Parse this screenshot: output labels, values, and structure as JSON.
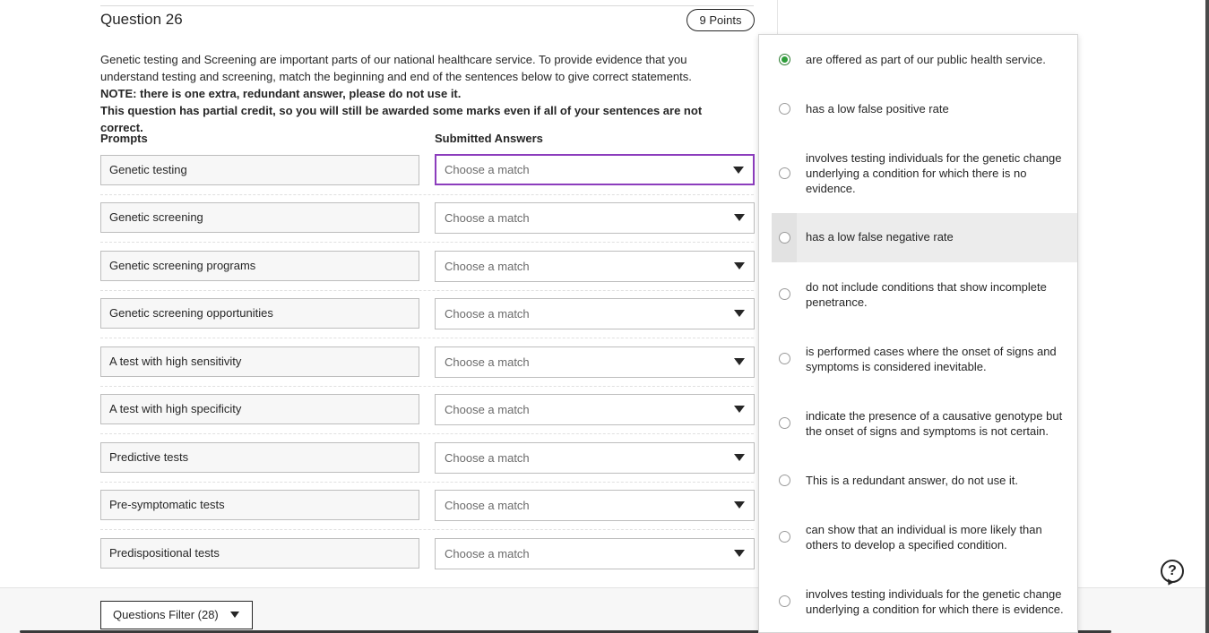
{
  "question": {
    "title": "Question 26",
    "points": "9 Points",
    "instructions": [
      "Genetic testing and Screening are important parts of our national healthcare service. To provide evidence that you understand testing and screening, match the beginning and end of the sentences below to give correct statements."
    ],
    "note": "NOTE: there is one extra, redundant answer, please do not use it.",
    "partial_credit": "This question has partial credit, so you will still be awarded some marks even if all of your sentences are not correct."
  },
  "columns": {
    "prompts": "Prompts",
    "answers": "Submitted Answers"
  },
  "rows": [
    {
      "prompt": "Genetic testing",
      "answer": "Choose a match"
    },
    {
      "prompt": "Genetic screening",
      "answer": "Choose a match"
    },
    {
      "prompt": "Genetic screening programs",
      "answer": "Choose a match"
    },
    {
      "prompt": "Genetic screening opportunities",
      "answer": "Choose a match"
    },
    {
      "prompt": "A test with high sensitivity",
      "answer": "Choose a match"
    },
    {
      "prompt": "A test with high specificity",
      "answer": "Choose a match"
    },
    {
      "prompt": "Predictive tests",
      "answer": "Choose a match"
    },
    {
      "prompt": "Pre-symptomatic tests",
      "answer": "Choose a match"
    },
    {
      "prompt": "Predispositional tests",
      "answer": "Choose a match"
    }
  ],
  "dropdown": {
    "options": [
      {
        "label": "are offered as part of our public health service.",
        "selected": true
      },
      {
        "label": "has a low false positive rate",
        "selected": false
      },
      {
        "label": "involves testing individuals for the genetic change underlying a condition for which there is no evidence.",
        "selected": false
      },
      {
        "label": "has a low false negative rate",
        "selected": false,
        "highlighted": true
      },
      {
        "label": "do not include conditions that show incomplete penetrance.",
        "selected": false
      },
      {
        "label": "is performed cases where the onset of signs and symptoms is considered inevitable.",
        "selected": false
      },
      {
        "label": "indicate the presence of a causative genotype but the onset of signs and symptoms is not certain.",
        "selected": false
      },
      {
        "label": "This is a redundant answer, do not use it.",
        "selected": false
      },
      {
        "label": "can show that an individual is more likely than others to develop a specified condition.",
        "selected": false
      },
      {
        "label": "involves testing individuals for the genetic change underlying a condition for which there is evidence.",
        "selected": false
      }
    ]
  },
  "footer": {
    "filter_label": "Questions Filter (28)"
  },
  "icons": {
    "help": "help-bubble-icon",
    "dropdown": "chevron-down-icon",
    "radio": "radio-icon"
  },
  "colors": {
    "focus_border": "#8c3dbd",
    "selected_radio": "#2e9e3a",
    "highlight_row": "#ececec"
  }
}
